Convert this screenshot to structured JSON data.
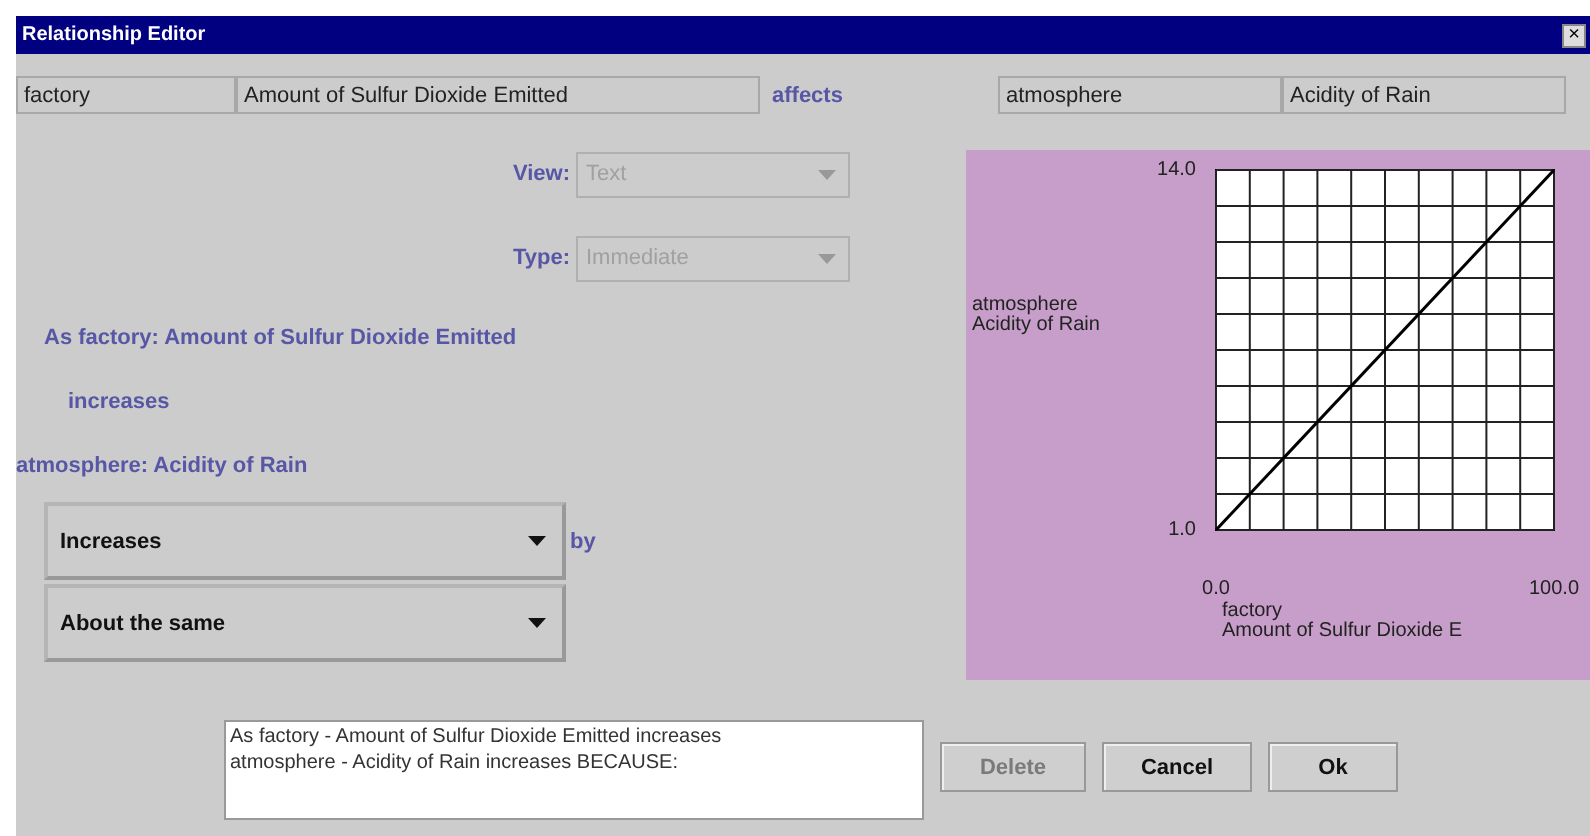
{
  "window": {
    "title": "Relationship Editor",
    "close": "×"
  },
  "source": {
    "entity": "factory",
    "variable": "Amount of Sulfur Dioxide Emitted"
  },
  "relation_label": "affects",
  "target": {
    "entity": "atmosphere",
    "variable": "Acidity of Rain"
  },
  "view": {
    "label": "View:",
    "value": "Text",
    "disabled": true
  },
  "type": {
    "label": "Type:",
    "value": "Immediate",
    "disabled": true
  },
  "description": [
    "As factory: Amount of Sulfur Dioxide Emitted",
    "increases",
    "atmosphere: Acidity of Rain"
  ],
  "direction": {
    "value": "Increases",
    "suffix": "by"
  },
  "amount": {
    "value": "About the same"
  },
  "reason": "As factory - Amount of Sulfur Dioxide Emitted increases\natmosphere - Acidity of Rain increases BECAUSE:",
  "buttons": [
    {
      "label": "Delete",
      "disabled": true
    },
    {
      "label": "Cancel",
      "disabled": false
    },
    {
      "label": "Ok",
      "disabled": false
    }
  ],
  "graph": {
    "chart_data": {
      "type": "line",
      "xlabel": "factory\nAmount of Sulfur Dioxide E",
      "ylabel": "atmosphere\nAcidity of Rain",
      "x": [
        0,
        100
      ],
      "xlim": [
        0,
        100
      ],
      "ylim": [
        1,
        14
      ],
      "xticks": [
        {
          "value": 0,
          "label": "0.0"
        },
        {
          "value": 100,
          "label": "100.0"
        }
      ],
      "yticks": [
        {
          "value": 1,
          "label": "1.0"
        },
        {
          "value": 14,
          "label": "14.0"
        }
      ],
      "series": [
        {
          "color": "#000000",
          "values": [
            1,
            14
          ]
        }
      ]
    }
  }
}
